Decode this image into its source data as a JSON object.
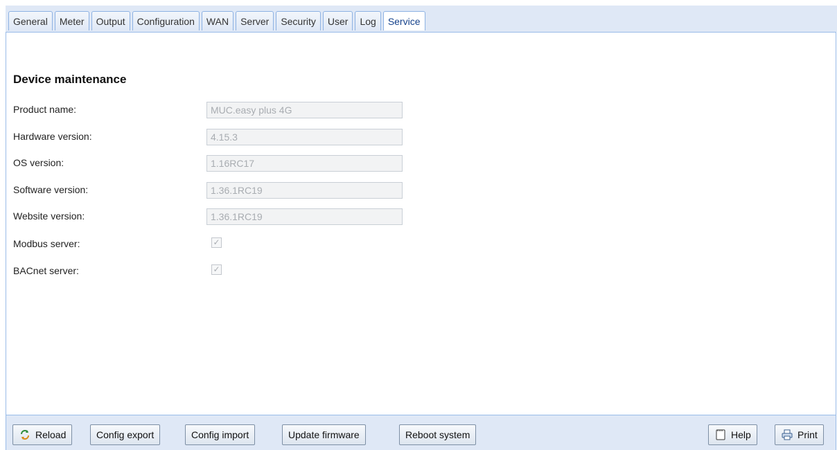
{
  "tabs": [
    {
      "label": "General"
    },
    {
      "label": "Meter"
    },
    {
      "label": "Output"
    },
    {
      "label": "Configuration"
    },
    {
      "label": "WAN"
    },
    {
      "label": "Server"
    },
    {
      "label": "Security"
    },
    {
      "label": "User"
    },
    {
      "label": "Log"
    },
    {
      "label": "Service",
      "active": true
    }
  ],
  "section": {
    "title": "Device maintenance"
  },
  "fields": {
    "product_name": {
      "label": "Product name:",
      "value": "MUC.easy plus 4G"
    },
    "hardware_version": {
      "label": "Hardware version:",
      "value": "4.15.3"
    },
    "os_version": {
      "label": "OS version:",
      "value": "1.16RC17"
    },
    "software_version": {
      "label": "Software version:",
      "value": "1.36.1RC19"
    },
    "website_version": {
      "label": "Website version:",
      "value": "1.36.1RC19"
    },
    "modbus_server": {
      "label": "Modbus server:",
      "checked": true,
      "disabled": true
    },
    "bacnet_server": {
      "label": "BACnet server:",
      "checked": true,
      "disabled": true
    }
  },
  "toolbar": {
    "reload": "Reload",
    "config_export": "Config export",
    "config_import": "Config import",
    "update_firmware": "Update firmware",
    "reboot_system": "Reboot system",
    "help": "Help",
    "print": "Print"
  },
  "icons": {
    "reload": "reload-icon",
    "help": "help-document-icon",
    "print": "printer-icon"
  },
  "colors": {
    "tab_bar": "#dfe8f6",
    "panel_border": "#99bbe8",
    "tab_text": "#15428b",
    "disabled_text": "#a8acb1"
  }
}
